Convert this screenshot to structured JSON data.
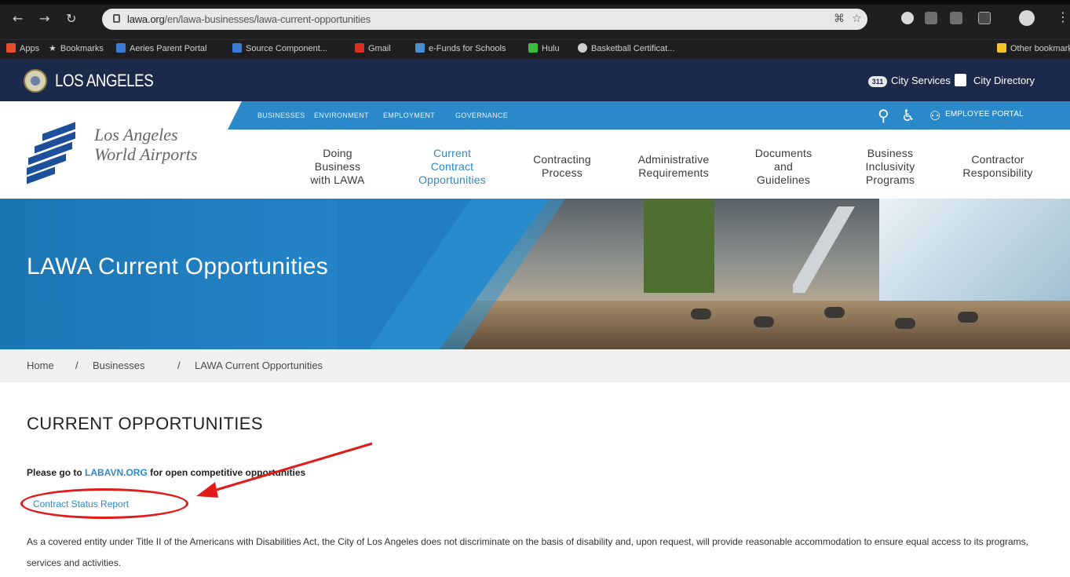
{
  "browser": {
    "url_host": "lawa.org",
    "url_path": "/en/lawa-businesses/lawa-current-opportunities",
    "bookmarks": [
      {
        "label": "Apps",
        "color": "#e44d2e"
      },
      {
        "label": "Bookmarks",
        "color": "#cfcfcf"
      },
      {
        "label": "Aeries Parent Portal",
        "color": "#3a7bd5"
      },
      {
        "label": "Source Component...",
        "color": "#3a7bd5"
      },
      {
        "label": "Gmail",
        "color": "#d93025"
      },
      {
        "label": "e-Funds for Schools",
        "color": "#4a8fd0"
      },
      {
        "label": "Hulu",
        "color": "#3dbb3d"
      },
      {
        "label": "Basketball Certificat...",
        "color": "#cfcfcf"
      }
    ],
    "other_bookmarks": "Other bookmarks"
  },
  "city_bar": {
    "title": "LOS ANGELES",
    "badge": "311",
    "city_services": "City Services",
    "city_directory": "City Directory"
  },
  "lawa": {
    "logo_line1": "Los Angeles",
    "logo_line2": "World Airports",
    "utility_links": [
      "BUSINESSES",
      "ENVIRONMENT",
      "EMPLOYMENT",
      "GOVERNANCE"
    ],
    "employee_portal": "EMPLOYEE PORTAL",
    "nav": [
      {
        "label": "Doing\nBusiness\nwith LAWA",
        "active": false
      },
      {
        "label": "Current\nContract\nOpportunities",
        "active": true
      },
      {
        "label": "Contracting\nProcess",
        "active": false
      },
      {
        "label": "Administrative\nRequirements",
        "active": false
      },
      {
        "label": "Documents\nand\nGuidelines",
        "active": false
      },
      {
        "label": "Business\nInclusivity\nPrograms",
        "active": false
      },
      {
        "label": "Contractor\nResponsibility",
        "active": false
      }
    ]
  },
  "banner": {
    "title": "LAWA Current Opportunities"
  },
  "breadcrumb": [
    "Home",
    "Businesses",
    "LAWA Current Opportunities"
  ],
  "content": {
    "heading": "CURRENT OPPORTUNITIES",
    "notice_pre": "Please go to",
    "notice_link": "LABAVN.ORG",
    "notice_post": "for open competitive opportunities",
    "status_report": "Contract Status Report",
    "ada_text": "As a covered entity under Title II of the Americans with Disabilities Act, the City of Los Angeles does not discriminate on the basis of disability and, upon request, will provide reasonable accommodation to ensure equal access to its programs, services and activities."
  },
  "colors": {
    "accent": "#2b88c9",
    "annotation": "#e11a1a",
    "city_bar": "#1b2a4a"
  }
}
